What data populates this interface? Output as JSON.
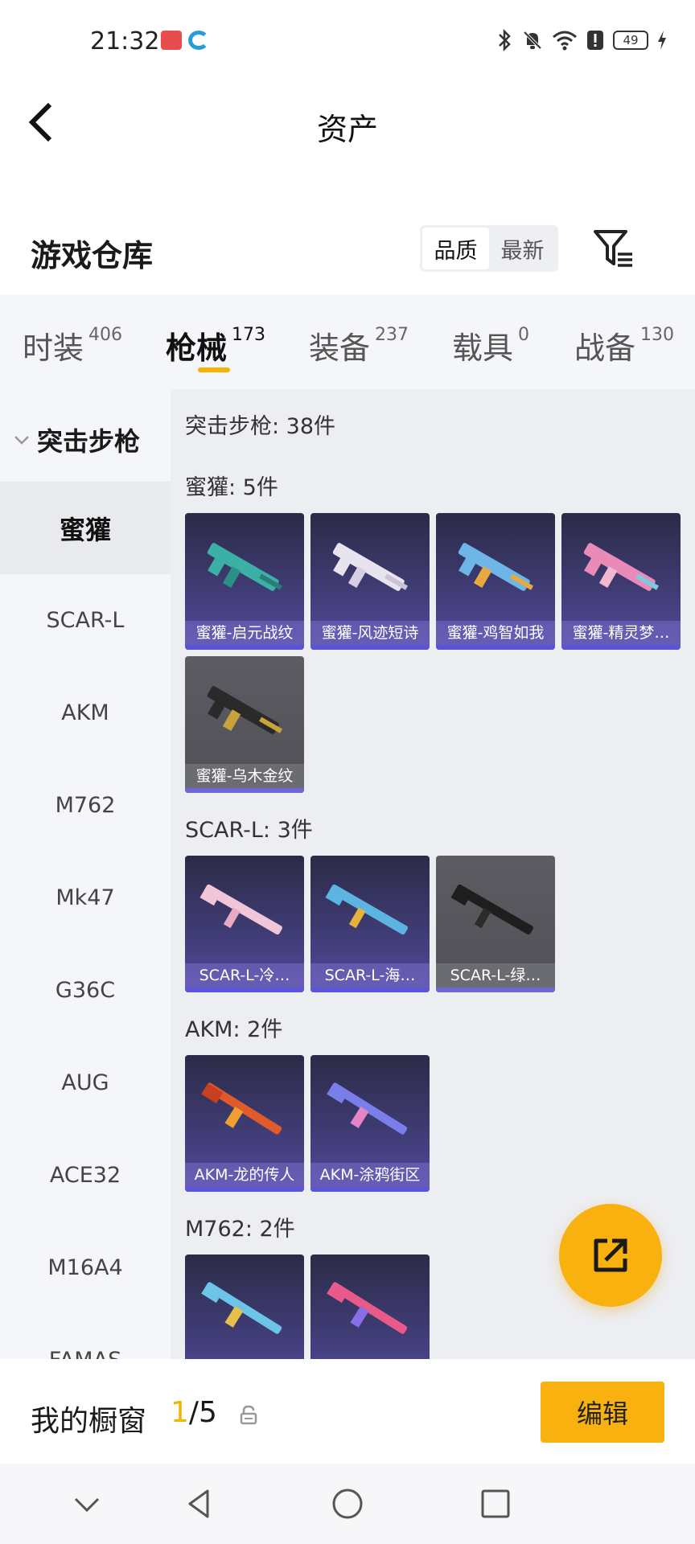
{
  "status_bar": {
    "time": "21:32",
    "battery": "49"
  },
  "header": {
    "title": "资产"
  },
  "warehouse": {
    "title": "游戏仓库",
    "sort_options": [
      "品质",
      "最新"
    ],
    "sort_selected": "品质"
  },
  "tabs": [
    {
      "label": "时装",
      "count": "406"
    },
    {
      "label": "枪械",
      "count": "173",
      "active": true
    },
    {
      "label": "装备",
      "count": "237"
    },
    {
      "label": "载具",
      "count": "0"
    },
    {
      "label": "战备",
      "count": "130"
    }
  ],
  "sidebar": {
    "category": "突击步枪",
    "items": [
      "蜜獾",
      "SCAR-L",
      "AKM",
      "M762",
      "Mk47",
      "G36C",
      "AUG",
      "ACE32",
      "M16A4",
      "FAMAS"
    ],
    "active": "蜜獾"
  },
  "content": {
    "summary": "突击步枪: 38件",
    "sections": [
      {
        "title": "蜜獾: 5件",
        "items": [
          "蜜獾-启元战纹",
          "蜜獾-风迹短诗",
          "蜜獾-鸡智如我",
          "蜜獾-精灵梦…",
          "蜜獾-乌木金纹"
        ]
      },
      {
        "title": "SCAR-L: 3件",
        "items": [
          "SCAR-L-冷…",
          "SCAR-L-海…",
          "SCAR-L-绿…"
        ]
      },
      {
        "title": "AKM: 2件",
        "items": [
          "AKM-龙的传人",
          "AKM-涂鸦街区"
        ]
      },
      {
        "title": "M762: 2件",
        "items": []
      }
    ]
  },
  "bottom_bar": {
    "window_label": "我的橱窗",
    "window_current": "1",
    "window_total": "/5",
    "edit_label": "编辑"
  },
  "colors": {
    "accent": "#f8b10e",
    "purple_card": "#413d78",
    "gray_card": "#5c5c62"
  }
}
